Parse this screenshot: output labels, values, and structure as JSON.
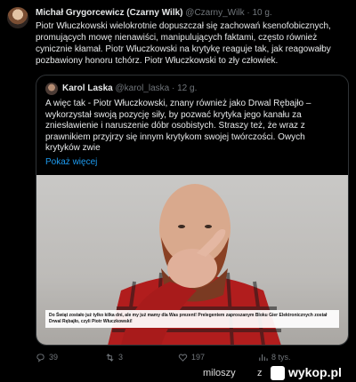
{
  "author": {
    "name": "Michał Grygorcewicz (Czarny Wilk)",
    "handle": "@Czarny_Wilk",
    "time": "· 10 g."
  },
  "tweet_text": "Piotr Włuczkowski wielokrotnie dopuszczał się zachowań ksenofobicznych, promujących mowę nienawiści, manipulujących faktami, często również cynicznie kłamał. Piotr Włuczkowski na krytykę reaguje tak, jak reagowałby pozbawiony honoru tchórz. Piotr Włuczkowski to zły człowiek.",
  "quote": {
    "name": "Karol Laska",
    "handle": "@karol_laska",
    "time": "· 12 g.",
    "text": "A więc tak - Piotr Włuczkowski, znany również jako Drwal Rębajło – wykorzystał swoją pozycję siły, by pozwać krytyka jego kanału za zniesławienie i naruszenie dóbr osobistych. Straszy też, że wraz z prawnikiem przyjrzy się innym krytykom swojej twórczości. Owych krytyków zwie",
    "show_more": "Pokaż więcej",
    "image_caption": "Do Świąt zostało już tylko kilka dni, ale my już mamy dla Was prezent! Prelegentem zaproszanym Bloku Gier Elektronicznych został Drwal Rębajło, czyli Piotr Włuczkowski!"
  },
  "actions": {
    "replies": "39",
    "reposts": "3",
    "likes": "197",
    "views": "8 tys."
  },
  "watermark": {
    "user": "miloszy",
    "z": "z",
    "site": "wykop.pl"
  },
  "colors": {
    "background": "#000000",
    "text": "#e7e9ea",
    "muted": "#71767b",
    "link": "#1d9bf0",
    "border": "#2f3336"
  }
}
